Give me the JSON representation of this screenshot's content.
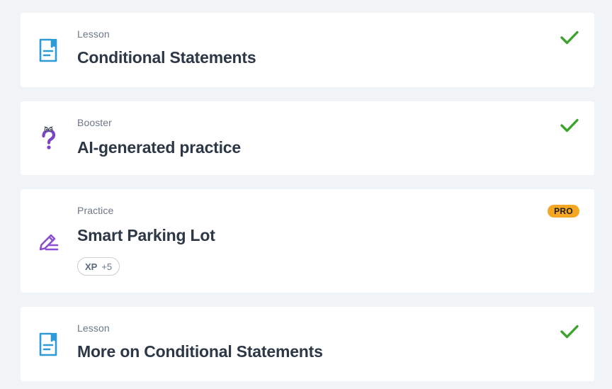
{
  "items": [
    {
      "kind": "Lesson",
      "title": "Conditional Statements",
      "icon": "lesson-doc-icon",
      "status": "completed"
    },
    {
      "kind": "Booster",
      "title": "AI-generated practice",
      "icon": "booster-question-icon",
      "status": "completed"
    },
    {
      "kind": "Practice",
      "title": "Smart Parking Lot",
      "icon": "practice-pencil-icon",
      "status": "locked",
      "badge": "PRO",
      "xp_label": "XP",
      "xp_value": "+5"
    },
    {
      "kind": "Lesson",
      "title": "More on Conditional Statements",
      "icon": "lesson-doc-icon",
      "status": "completed"
    }
  ],
  "colors": {
    "lesson_icon": "#2e9bd9",
    "practice_icon": "#8b4fcf",
    "booster_icon": "#7a45c8",
    "check": "#3aa52a",
    "pro_badge": "#f5a623",
    "background": "#f1f4f7"
  }
}
